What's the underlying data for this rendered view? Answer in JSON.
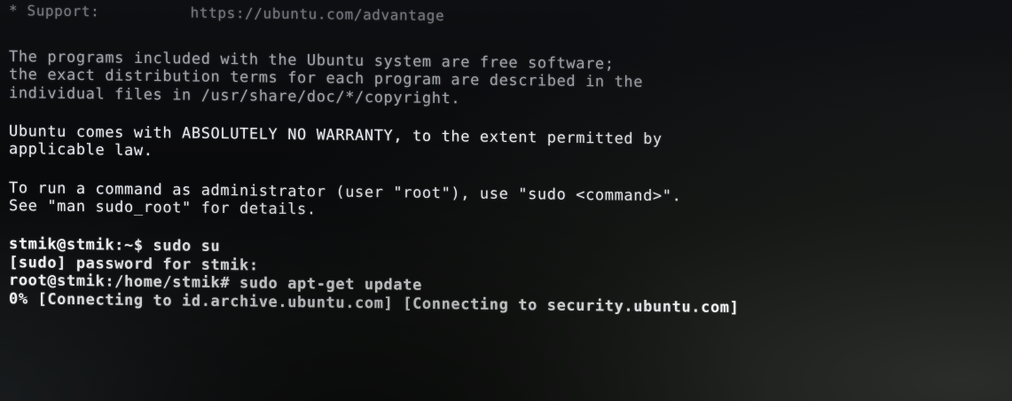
{
  "terminal": {
    "lines": {
      "support_line": "* Support:          https://ubuntu.com/advantage",
      "license_1": "The programs included with the Ubuntu system are free software;",
      "license_2": "the exact distribution terms for each program are described in the",
      "license_3": "individual files in /usr/share/doc/*/copyright.",
      "warranty_1": "Ubuntu comes with ABSOLUTELY NO WARRANTY, to the extent permitted by",
      "warranty_2": "applicable law.",
      "sudo_hint_1": "To run a command as administrator (user \"root\"), use \"sudo <command>\".",
      "sudo_hint_2": "See \"man sudo_root\" for details.",
      "cmd_1": "stmik@stmik:~$ sudo su",
      "cmd_2": "[sudo] password for stmik:",
      "cmd_3": "root@stmik:/home/stmik# sudo apt-get update",
      "progress": "0% [Connecting to id.archive.ubuntu.com] [Connecting to security.ubuntu.com]"
    }
  },
  "colors": {
    "background": "#08090b",
    "text": "#e6e8ee"
  }
}
